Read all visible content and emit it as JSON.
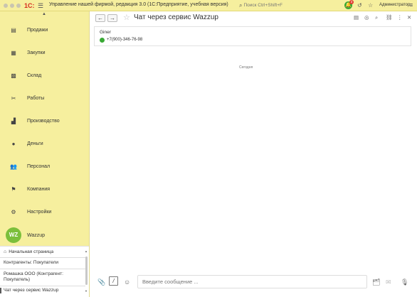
{
  "titlebar": {
    "logo": "1С:",
    "title": "Управление нашей фирмой, редакция 3.0  (1С:Предприятие, учебная версия)",
    "search_placeholder": "Поиск Ctrl+Shift+F",
    "notification_count": "3",
    "user": "Администратор"
  },
  "sidebar": {
    "items": [
      {
        "label": "Продажи",
        "icon": "sales-icon"
      },
      {
        "label": "Закупки",
        "icon": "purchases-icon"
      },
      {
        "label": "Склад",
        "icon": "warehouse-icon"
      },
      {
        "label": "Работы",
        "icon": "works-icon"
      },
      {
        "label": "Производство",
        "icon": "production-icon"
      },
      {
        "label": "Деньги",
        "icon": "money-icon"
      },
      {
        "label": "Персонал",
        "icon": "personnel-icon"
      },
      {
        "label": "Компания",
        "icon": "company-icon"
      },
      {
        "label": "Настройки",
        "icon": "settings-icon"
      },
      {
        "label": "Wazzup",
        "avatar": "WZ"
      }
    ]
  },
  "windows": {
    "home": "Начальная страница",
    "items": [
      "Контрагенты: Покупатели",
      "Ромашка ООО (Контрагент: Покупатель)",
      "Чат через сервис Wazzup"
    ]
  },
  "main": {
    "title": "Чат через сервис Wazzup",
    "contact_name": "Giner",
    "contact_phone": "+7(900)-346-76-98",
    "date_separator": "Сегодня",
    "composer_placeholder": "Введите сообщение ..."
  }
}
